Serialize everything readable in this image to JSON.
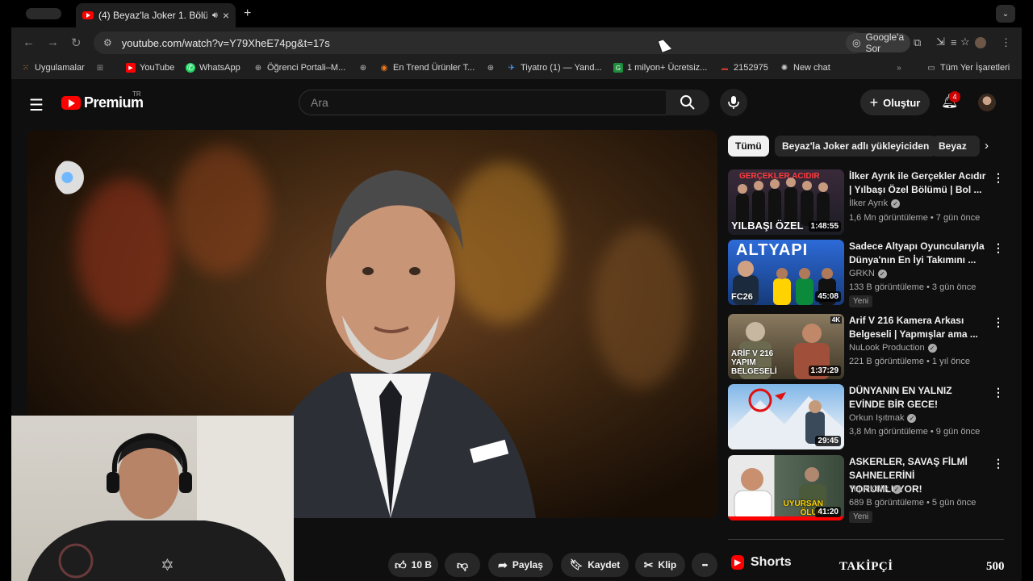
{
  "browser": {
    "tab_title": "(4) Beyaz'la Joker 1. Bölü",
    "tab_close": "×",
    "new_tab": "+",
    "url": "youtube.com/watch?v=Y79XheE74pg&t=17s",
    "google_lens_label": "Google'a Sor"
  },
  "bookmarks": [
    {
      "label": "Uygulamalar",
      "icon": "apps-grid-icon"
    },
    {
      "label": "YouTube",
      "icon": "youtube-icon"
    },
    {
      "label": "WhatsApp",
      "icon": "whatsapp-icon"
    },
    {
      "label": "Öğrenci Portali–M...",
      "icon": "globe-icon"
    },
    {
      "label": "En Trend Ürünler T...",
      "icon": "trendyol-icon"
    },
    {
      "label": "Tiyatro (1) — Yand...",
      "icon": "yandex-icon"
    },
    {
      "label": "1 milyon+ Ücretsiz...",
      "icon": "freepik-icon"
    },
    {
      "label": "2152975",
      "icon": "number-icon"
    },
    {
      "label": "New chat",
      "icon": "chatgpt-icon"
    },
    {
      "label": "Tüm Yer İşaretleri",
      "icon": "folder-icon"
    }
  ],
  "masthead": {
    "logo_text": "Premium",
    "logo_region": "TR",
    "search_placeholder": "Ara",
    "create_label": "Oluştur",
    "notification_count": "4"
  },
  "chips": [
    "Tümü",
    "Beyaz'la Joker adlı yükleyiciden",
    "Beyaz"
  ],
  "recommendations": [
    {
      "thumb_text": "GERÇEKLER ACIDIR / YILBAŞI ÖZEL",
      "thumb_top": "GERÇEKLER ACIDIR",
      "thumb_bottom": "YILBAŞI ÖZEL",
      "duration": "1:48:55",
      "title": "İlker Ayrık ile Gerçekler Acıdır | Yılbaşı Özel Bölümü | Bol ...",
      "channel": "İlker Ayrık",
      "meta": "1,6 Mn görüntüleme • 7 gün önce",
      "badge": ""
    },
    {
      "thumb_top": "ALTYAPI",
      "thumb_bottom": "FC26",
      "duration": "45:08",
      "title": "Sadece Altyapı Oyuncularıyla Dünya'nın En İyi Takımını ...",
      "channel": "GRKN",
      "meta": "133 B görüntüleme • 3 gün önce",
      "badge": "Yeni"
    },
    {
      "thumb_top": "4K",
      "thumb_bottom": "ARİF V 216 YAPIM BELGESELİ",
      "duration": "1:37:29",
      "title": "Arif V 216 Kamera Arkası Belgeseli | Yapmışlar ama ...",
      "channel": "NuLook Production",
      "meta": "221 B görüntüleme • 1 yıl önce",
      "badge": ""
    },
    {
      "thumb_top": "",
      "thumb_bottom": "",
      "duration": "29:45",
      "title": "DÜNYANIN EN YALNIZ EVİNDE BİR GECE!",
      "channel": "Orkun Işıtmak",
      "meta": "3,8 Mn görüntüleme • 9 gün önce",
      "badge": ""
    },
    {
      "thumb_top": "",
      "thumb_bottom": "UYURSAN ÖLÜR",
      "duration": "41:20",
      "title": "ASKERLER, SAVAŞ FİLMİ SAHNELERİNİ YORUMLUYOR!",
      "channel": "TepkiKolik",
      "meta": "689 B görüntüleme • 5 gün önce",
      "badge": "Yeni"
    }
  ],
  "actions": {
    "like_count": "10 B",
    "share": "Paylaş",
    "save": "Kaydet",
    "clip": "Klip",
    "more": "•••"
  },
  "shorts_label": "Shorts",
  "stream_overlay": {
    "follow_label": "TAKİPÇİ",
    "follow_count": "500"
  },
  "colors": {
    "accent_red": "#ff0000",
    "background": "#0f0f0f",
    "chip_bg": "#272727"
  }
}
